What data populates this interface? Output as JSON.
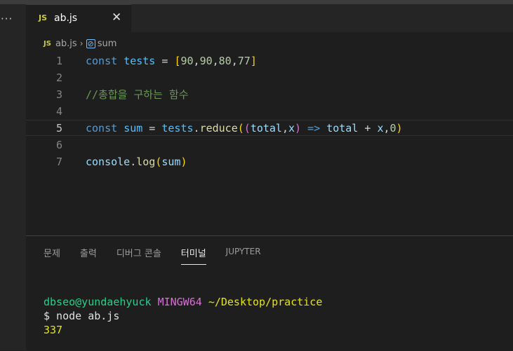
{
  "window": {
    "more_label": "···"
  },
  "tab": {
    "badge": "JS",
    "title": "ab.js",
    "close": "✕"
  },
  "breadcrumb": {
    "badge": "JS",
    "file": "ab.js",
    "separator": "›",
    "symbol_icon": "[⊘]",
    "symbol": "sum"
  },
  "editor": {
    "lines": [
      {
        "num": "1",
        "text": "const tests = [90,90,80,77]"
      },
      {
        "num": "2",
        "text": ""
      },
      {
        "num": "3",
        "text": "//총합을 구하는 함수"
      },
      {
        "num": "4",
        "text": ""
      },
      {
        "num": "5",
        "text": "const sum = tests.reduce((total,x) => total + x,0)"
      },
      {
        "num": "6",
        "text": ""
      },
      {
        "num": "7",
        "text": "console.log(sum)"
      }
    ],
    "current_line": "5"
  },
  "panel": {
    "tabs": [
      "문제",
      "출력",
      "디버그 콘솔",
      "터미널",
      "JUPYTER"
    ],
    "active_tab": "터미널"
  },
  "terminal": {
    "user": "dbseo@yundaehyuck",
    "host": "MINGW64",
    "path": "~/Desktop/practice",
    "command": "$ node ab.js",
    "output": "337"
  },
  "colors": {
    "keyword": "#569cd6",
    "variable": "#4fc1ff",
    "number": "#b5cea8",
    "comment": "#6a9955",
    "js_badge": "#cbcb41",
    "terminal_user": "#23d18b",
    "terminal_host": "#d670d6",
    "terminal_path": "#e5e510"
  }
}
